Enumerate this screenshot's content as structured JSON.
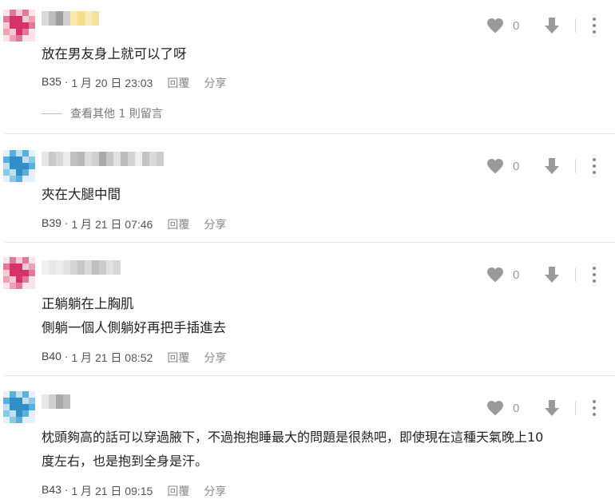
{
  "colors": {
    "icon": "#9a9a9a",
    "text": "#222222",
    "meta": "#555555",
    "divider": "#e4e4e4"
  },
  "comments": [
    {
      "avatar_palette": [
        "#f6c9d3",
        "#e07a98",
        "#d6336b",
        "#efa0b5",
        "#fbe3ea"
      ],
      "text_lines": [
        "放在男友身上就可以了呀"
      ],
      "floor": "B35",
      "time": "1 月 20 日 23:03",
      "reply_label": "回覆",
      "share_label": "分享",
      "likes": "0",
      "more_replies": "查看其他 1 則留言"
    },
    {
      "avatar_palette": [
        "#bfe0f1",
        "#5ab0dc",
        "#2f8fc6",
        "#8ac8e8",
        "#e3f2fa"
      ],
      "text_lines": [
        "夾在大腿中間"
      ],
      "floor": "B39",
      "time": "1 月 21 日 07:46",
      "reply_label": "回覆",
      "share_label": "分享",
      "likes": "0"
    },
    {
      "avatar_palette": [
        "#f6c9d3",
        "#e07a98",
        "#d6336b",
        "#efa0b5",
        "#fbe3ea"
      ],
      "text_lines": [
        "正躺躺在上胸肌",
        "側躺一個人側躺好再把手插進去"
      ],
      "floor": "B40",
      "time": "1 月 21 日 08:52",
      "reply_label": "回覆",
      "share_label": "分享",
      "likes": "0"
    },
    {
      "avatar_palette": [
        "#bfe0f1",
        "#5ab0dc",
        "#2f8fc6",
        "#8ac8e8",
        "#e3f2fa"
      ],
      "text_lines": [
        "枕頭夠高的話可以穿過腋下，不過抱抱睡最大的問題是很熱吧，即使現在這種天氣晚上10",
        "度左右，也是抱到全身是汗。"
      ],
      "floor": "B43",
      "time": "1 月 21 日 09:15",
      "reply_label": "回覆",
      "share_label": "分享",
      "likes": "0"
    }
  ]
}
